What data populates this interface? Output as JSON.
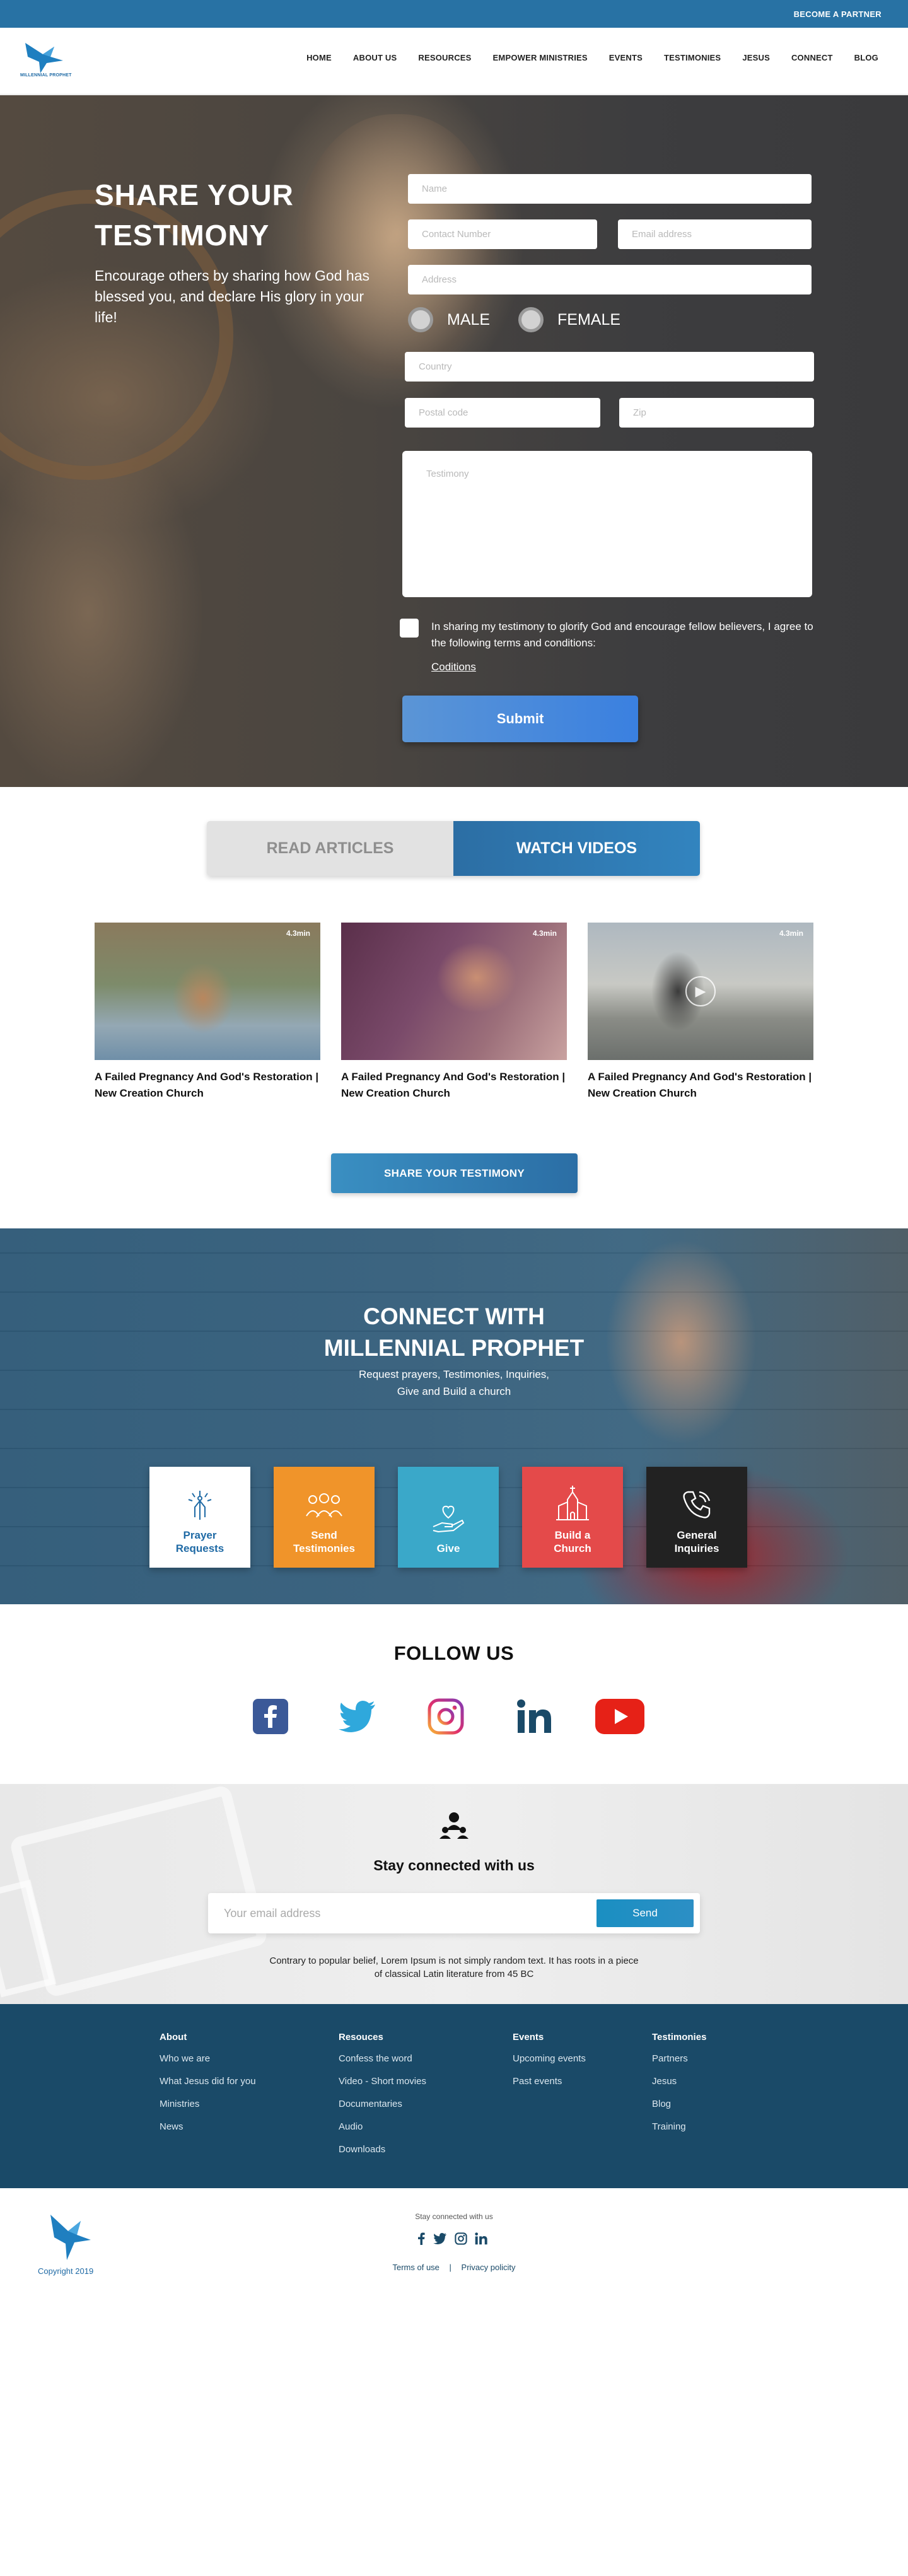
{
  "topbar": {
    "partner_label": "BECOME A PARTNER"
  },
  "brand": {
    "logo_text": "MILLENNIAL PROPHET"
  },
  "nav": {
    "items": [
      "HOME",
      "ABOUT US",
      "RESOURCES",
      "EMPOWER MINISTRIES",
      "EVENTS",
      "TESTIMONIES",
      "JESUS",
      "CONNECT",
      "BLOG"
    ]
  },
  "hero": {
    "title": "SHARE YOUR TESTIMONY",
    "subtitle": "Encourage others by sharing how God has blessed you, and declare His glory in your life!",
    "form": {
      "name_placeholder": "Name",
      "contact_placeholder": "Contact Number",
      "email_placeholder": "Email address",
      "address_placeholder": "Address",
      "gender_male": "MALE",
      "gender_female": "FEMALE",
      "country_placeholder": "Country",
      "postal_placeholder": "Postal code",
      "zip_placeholder": "Zip",
      "testimony_placeholder": "Testimony",
      "terms_text": "In sharing my testimony to glorify God and encourage fellow believers, I agree to the following terms and conditions:",
      "conditions_link": "Coditions",
      "submit_label": "Submit"
    }
  },
  "tabs": {
    "read_articles": "READ ARTICLES",
    "watch_videos": "WATCH VIDEOS"
  },
  "videos": [
    {
      "duration": "4.3min",
      "title": "A Failed Pregnancy And God's Restoration | New Creation Church"
    },
    {
      "duration": "4.3min",
      "title": "A Failed Pregnancy And God's Restoration | New Creation Church"
    },
    {
      "duration": "4.3min",
      "title": "A Failed Pregnancy And God's Restoration | New Creation Church"
    }
  ],
  "share_button": "SHARE YOUR TESTIMONY",
  "connect": {
    "title_line1": "CONNECT WITH",
    "title_line2": "MILLENNIAL PROPHET",
    "subtitle_line1": "Request prayers, Testimonies, Inquiries,",
    "subtitle_line2": "Give and Build a church",
    "cards": [
      {
        "line1": "Prayer",
        "line2": "Requests",
        "icon": "praying-hands-icon",
        "color": "#ffffff",
        "text_color": "#1f6aa5"
      },
      {
        "line1": "Send",
        "line2": "Testimonies",
        "icon": "people-group-icon",
        "color": "#f0942a",
        "text_color": "#ffffff"
      },
      {
        "line1": "Give",
        "line2": "",
        "icon": "heart-hand-icon",
        "color": "#3aa8c9",
        "text_color": "#ffffff"
      },
      {
        "line1": "Build a",
        "line2": "Church",
        "icon": "church-icon",
        "color": "#e44a4a",
        "text_color": "#ffffff"
      },
      {
        "line1": "General",
        "line2": "Inquiries",
        "icon": "phone-icon",
        "color": "#222222",
        "text_color": "#ffffff"
      }
    ]
  },
  "follow": {
    "title": "FOLLOW US",
    "icons": [
      "facebook-icon",
      "twitter-icon",
      "instagram-icon",
      "linkedin-icon",
      "youtube-icon"
    ]
  },
  "stay": {
    "title": "Stay connected with us",
    "email_placeholder": "Your email address",
    "send_label": "Send",
    "text_line1": "Contrary to popular belief, Lorem Ipsum is not simply random text. It has roots in a piece",
    "text_line2": "of classical Latin literature from 45 BC"
  },
  "footer": {
    "columns": [
      {
        "heading": "About",
        "links": [
          "Who we are",
          "What Jesus did for you",
          "Ministries",
          "News"
        ]
      },
      {
        "heading": "Resouces",
        "links": [
          "Confess the word",
          "Video - Short movies",
          "Documentaries",
          "Audio",
          "Downloads"
        ]
      },
      {
        "heading": "Events",
        "links": [
          "Upcoming events",
          "Past events"
        ]
      },
      {
        "heading": "Testimonies",
        "links": [
          "Partners",
          "Jesus",
          "Blog",
          "Training"
        ]
      }
    ]
  },
  "bottom": {
    "copyright": "Copyright 2019",
    "stay_connected": "Stay connected with us",
    "terms": "Terms of use",
    "separator": "|",
    "privacy": "Privacy policity"
  },
  "colors": {
    "primary": "#2872a4",
    "footer": "#1a4a68",
    "accent_blue": "#3a80e0"
  }
}
